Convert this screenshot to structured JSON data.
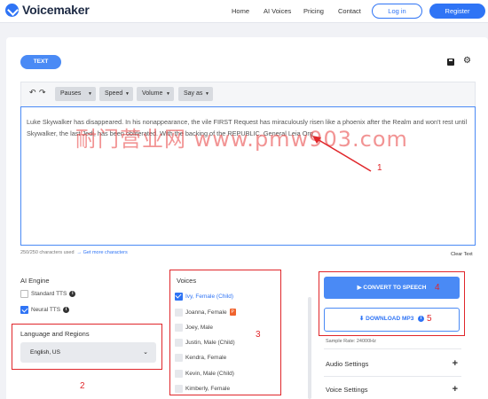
{
  "header": {
    "brand": "Voicemaker",
    "nav": [
      "Home",
      "AI Voices",
      "Pricing",
      "Contact"
    ],
    "login": "Log in",
    "register": "Register"
  },
  "editor": {
    "tab_label": "TEXT",
    "toolbar": [
      "Pauses",
      "Speed",
      "Volume",
      "Say as"
    ],
    "text": "Luke Skywalker has disappeared. In his nonappearance, the vile FIRST Request has miraculously risen like a phoenix after the Realm and won't rest until Skywalker, the last Jedi, has been obliterated. With the backing of the REPUBLIC, General Leia Org",
    "char_count": "250/250 characters used",
    "more_chars_link": "→ Get more characters",
    "clear_text": "Clear Text"
  },
  "ai_engine": {
    "title": "AI Engine",
    "options": [
      {
        "label": "Standard TTS",
        "checked": false
      },
      {
        "label": "Neural TTS",
        "checked": true
      }
    ]
  },
  "language": {
    "title": "Language and Regions",
    "value": "English, US"
  },
  "voices": {
    "title": "Voices",
    "items": [
      {
        "label": "Ivy, Female (Child)",
        "checked": true
      },
      {
        "label": "Joanna, Female",
        "checked": false,
        "badge": "P"
      },
      {
        "label": "Joey, Male",
        "checked": false
      },
      {
        "label": "Justin, Male (Child)",
        "checked": false
      },
      {
        "label": "Kendra, Female",
        "checked": false
      },
      {
        "label": "Kevin, Male (Child)",
        "checked": false
      },
      {
        "label": "Kimberly, Female",
        "checked": false
      }
    ]
  },
  "actions": {
    "convert": "CONVERT TO SPEECH",
    "download": "DOWNLOAD MP3",
    "sample_rate": "Sample Rate: 24000Hz",
    "audio_settings": "Audio Settings",
    "voice_settings": "Voice Settings"
  },
  "annotations": {
    "labels": [
      "1",
      "2",
      "3",
      "4",
      "5"
    ],
    "watermark": "耐门营业网 www.pmw903.com"
  },
  "colors": {
    "accent": "#2f74f5",
    "annotation": "#e0262a"
  }
}
